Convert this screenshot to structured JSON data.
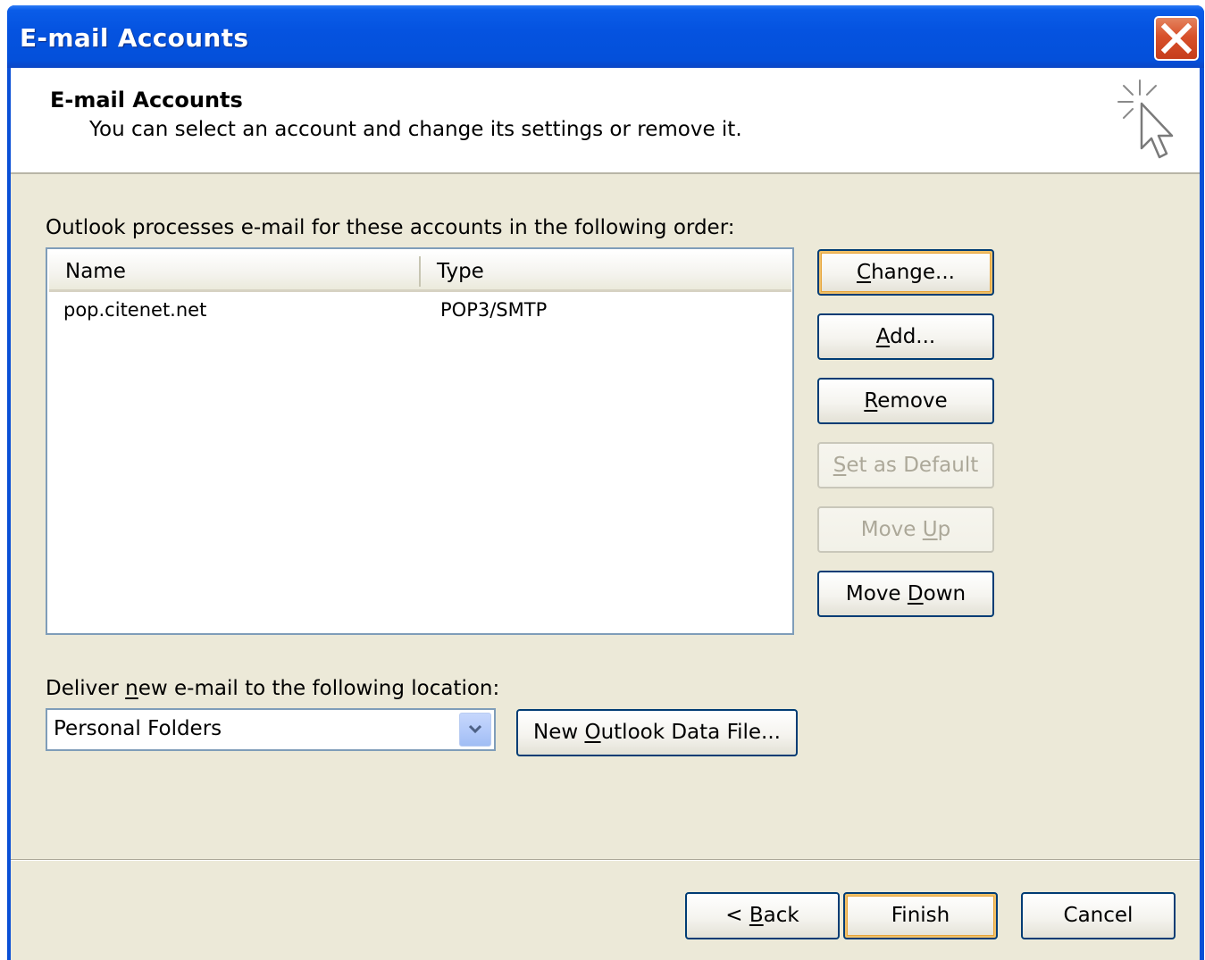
{
  "window": {
    "title": "E-mail Accounts"
  },
  "header": {
    "title": "E-mail Accounts",
    "subtitle": "You can select an account and change its settings or remove it."
  },
  "accounts": {
    "label": "Outlook processes e-mail for these accounts in the following order:",
    "columns": [
      "Name",
      "Type"
    ],
    "rows": [
      {
        "name": "pop.citenet.net",
        "type": "POP3/SMTP"
      }
    ]
  },
  "side_buttons": {
    "change": {
      "pre": "",
      "key": "C",
      "post": "hange..."
    },
    "add": {
      "pre": "",
      "key": "A",
      "post": "dd..."
    },
    "remove": {
      "pre": "",
      "key": "R",
      "post": "emove"
    },
    "set_default": {
      "pre": "",
      "key": "S",
      "post": "et as Default",
      "disabled": true
    },
    "move_up": {
      "pre": "Move ",
      "key": "U",
      "post": "p",
      "disabled": true
    },
    "move_down": {
      "pre": "Move ",
      "key": "D",
      "post": "own"
    }
  },
  "deliver": {
    "label_pre": "Deliver ",
    "label_key": "n",
    "label_post": "ew e-mail to the following location:",
    "selected": "Personal Folders",
    "new_file": {
      "pre": "New ",
      "key": "O",
      "post": "utlook Data File..."
    }
  },
  "footer": {
    "back": {
      "pre": "< ",
      "key": "B",
      "post": "ack"
    },
    "finish": "Finish",
    "cancel": "Cancel"
  },
  "colors": {
    "titlebar": "#0553e0",
    "dialog_bg": "#ece9d8",
    "button_border": "#003c74",
    "close_button": "#d8512b"
  },
  "icons": {
    "close": "close-icon",
    "wizard": "wizard-cursor-icon",
    "dropdown": "chevron-down-icon"
  }
}
